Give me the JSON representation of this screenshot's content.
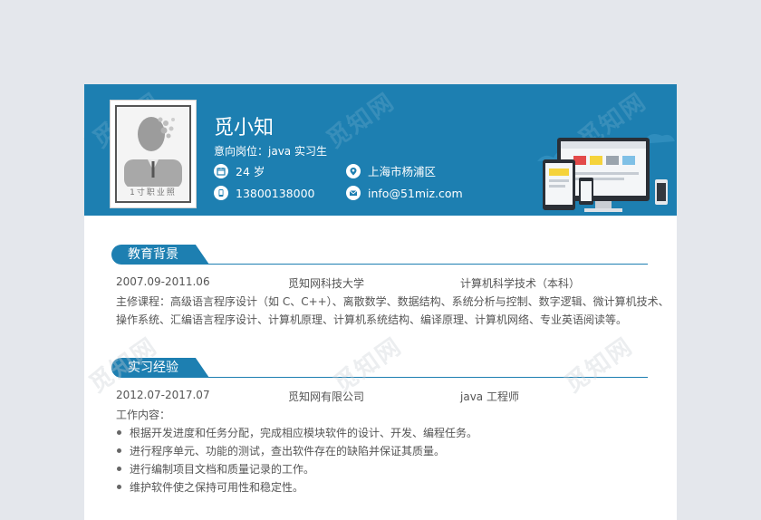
{
  "profile": {
    "name": "觅小知",
    "intent": "意向岗位：java 实习生",
    "photo_caption": "1寸职业照",
    "age": "24 岁",
    "location": "上海市杨浦区",
    "phone": "13800138000",
    "email": "info@51miz.com"
  },
  "watermark": "觅知网",
  "education": {
    "title": "教育背景",
    "period": "2007.09-2011.06",
    "school": "觅知网科技大学",
    "major": "计算机科学技术（本科）",
    "courses_line1": "主修课程：高级语言程序设计（如 C、C++）、离散数学、数据结构、系统分析与控制、数字逻辑、微计算机技术、",
    "courses_line2": "操作系统、汇编语言程序设计、计算机原理、计算机系统结构、编译原理、计算机网络、专业英语阅读等。"
  },
  "internship": {
    "title": "实习经验",
    "period": "2012.07-2017.07",
    "company": "觅知网有限公司",
    "role": "java 工程师",
    "content_label": "工作内容：",
    "items": [
      "根据开发进度和任务分配，完成相应模块软件的设计、开发、编程任务。",
      "进行程序单元、功能的测试，查出软件存在的缺陷并保证其质量。",
      "进行编制项目文档和质量记录的工作。",
      "维护软件使之保持可用性和稳定性。"
    ]
  },
  "colors": {
    "brand": "#1d7fb1",
    "background": "#e4e7ec"
  },
  "icons": [
    "calendar-icon",
    "location-pin-icon",
    "phone-icon",
    "mail-icon"
  ]
}
